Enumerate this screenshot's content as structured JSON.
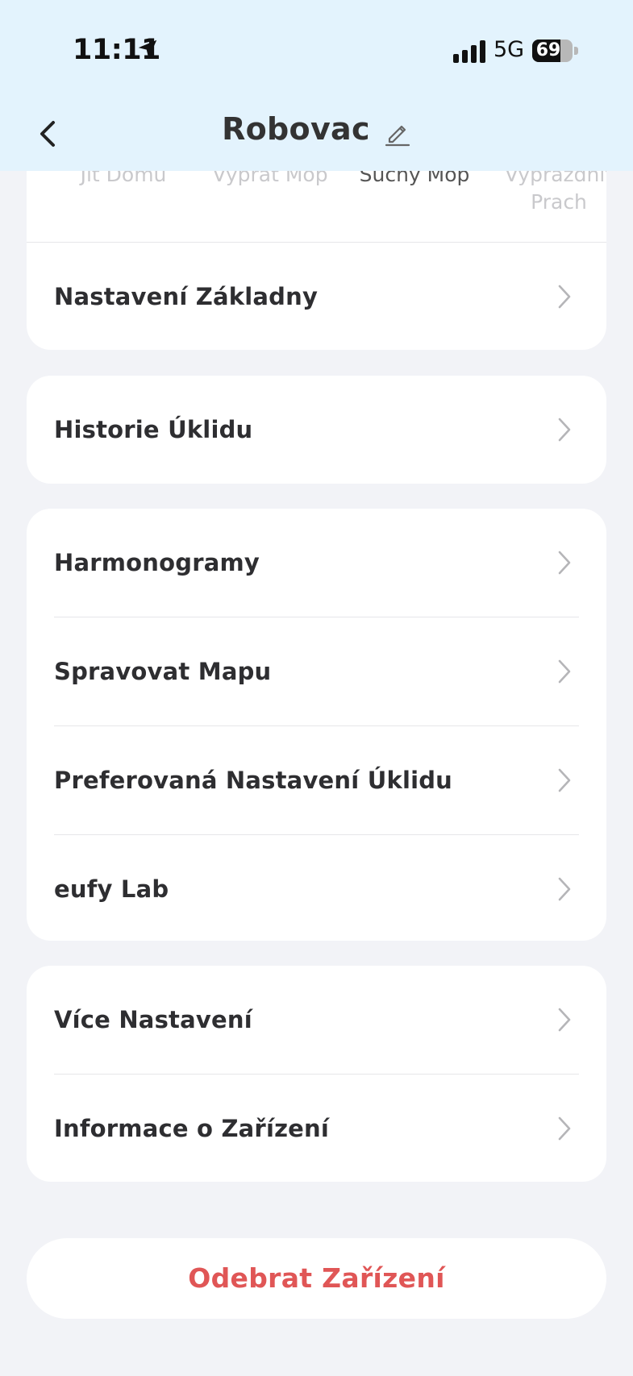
{
  "status_bar": {
    "time": "11:11",
    "network": "5G",
    "battery_percent": 69
  },
  "header": {
    "title": "Robovac"
  },
  "modes": [
    {
      "label": "Jít Domů",
      "active": false
    },
    {
      "label": "Vyprat Mop",
      "active": false
    },
    {
      "label": "Suchý Mop",
      "active": true
    },
    {
      "label": "Vyprázdnit Prach",
      "active": false
    }
  ],
  "groups": [
    {
      "items": [
        "Nastavení Základny"
      ]
    },
    {
      "items": [
        "Historie Úklidu"
      ]
    },
    {
      "items": [
        "Harmonogramy",
        "Spravovat Mapu",
        "Preferovaná Nastavení Úklidu",
        "eufy Lab"
      ]
    },
    {
      "items": [
        "Více Nastavení",
        "Informace o Zařízení"
      ]
    }
  ],
  "remove_button": {
    "label": "Odebrat Zařízení"
  },
  "colors": {
    "header_bg": "#e3f3fd",
    "page_bg": "#f2f3f7",
    "danger": "#e05656"
  }
}
